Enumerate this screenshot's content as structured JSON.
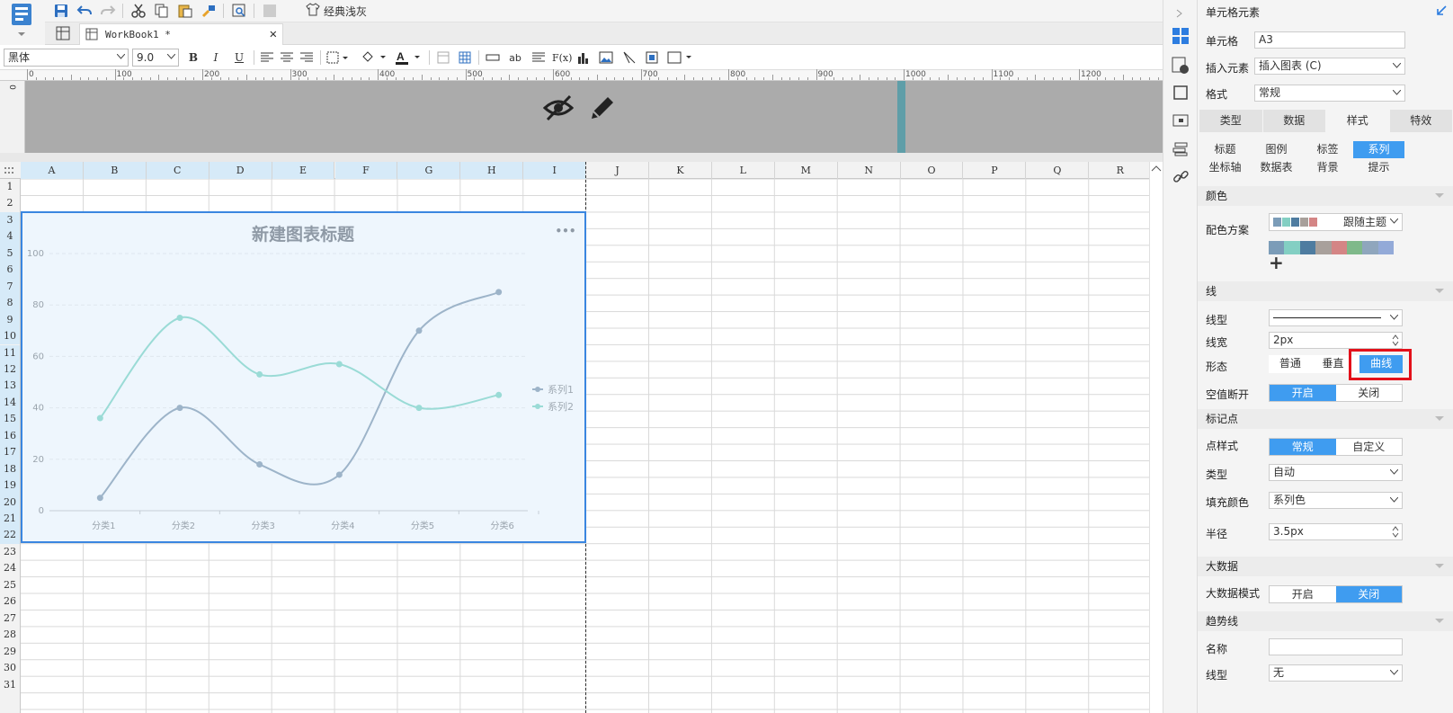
{
  "toolbar": {
    "theme_button": "经典浅灰",
    "font_name": "黑体",
    "font_size": "9.0",
    "bold": "B",
    "italic": "I",
    "underline": "U",
    "abc": "ab",
    "fx": "F(x)"
  },
  "tab": {
    "workbook": "WorkBook1 *"
  },
  "ruler": {
    "marks": [
      "0",
      "100",
      "200",
      "300",
      "400",
      "500",
      "600",
      "700",
      "800",
      "900",
      "1000",
      "1100",
      "1200"
    ]
  },
  "columns": [
    "A",
    "B",
    "C",
    "D",
    "E",
    "F",
    "G",
    "H",
    "I",
    "J",
    "K",
    "L",
    "M",
    "N",
    "O",
    "P",
    "Q",
    "R"
  ],
  "rows": [
    "1",
    "2",
    "3",
    "4",
    "5",
    "6",
    "7",
    "8",
    "9",
    "10",
    "11",
    "12",
    "13",
    "14",
    "15",
    "16",
    "17",
    "18",
    "19",
    "20",
    "21",
    "22",
    "23",
    "24",
    "25",
    "26",
    "27",
    "28",
    "29",
    "30",
    "31"
  ],
  "chart_data": {
    "type": "line",
    "title": "新建图表标题",
    "categories": [
      "分类1",
      "分类2",
      "分类3",
      "分类4",
      "分类5",
      "分类6"
    ],
    "series": [
      {
        "name": "系列1",
        "values": [
          5,
          40,
          18,
          14,
          70,
          85
        ],
        "color": "#9db4c9"
      },
      {
        "name": "系列2",
        "values": [
          36,
          75,
          53,
          57,
          40,
          45
        ],
        "color": "#9adbd6"
      }
    ],
    "yticks": [
      "0",
      "20",
      "40",
      "60",
      "80",
      "100"
    ],
    "ylim": [
      0,
      100
    ],
    "curve": "smooth",
    "legend": "right",
    "menu": "•••"
  },
  "panel": {
    "title": "单元格元素",
    "cell_label": "单元格",
    "cell_value": "A3",
    "insert_label": "插入元素",
    "insert_value": "插入图表 (C)",
    "format_label": "格式",
    "format_value": "常规",
    "tabs": [
      "类型",
      "数据",
      "样式",
      "特效"
    ],
    "subtabs_row1": [
      "标题",
      "图例",
      "标签",
      "系列"
    ],
    "subtabs_row2": [
      "坐标轴",
      "数据表",
      "背景",
      "提示"
    ],
    "color_section": "颜色",
    "scheme_label": "配色方案",
    "scheme_value": "跟随主题",
    "scheme_colors": [
      "#7b9cb8",
      "#83cfc3",
      "#4e7ca0",
      "#a8a09b",
      "#d48585",
      "#7fb98a",
      "#8fa6bd",
      "#93aad8"
    ],
    "plus": "+",
    "line_section": "线",
    "line_type_label": "线型",
    "line_width_label": "线宽",
    "line_width_value": "2px",
    "shape_label": "形态",
    "shape_options": [
      "普通",
      "垂直",
      "曲线"
    ],
    "null_break_label": "空值断开",
    "null_break_options": [
      "开启",
      "关闭"
    ],
    "marker_section": "标记点",
    "marker_style_label": "点样式",
    "marker_style_options": [
      "常规",
      "自定义"
    ],
    "marker_type_label": "类型",
    "marker_type_value": "自动",
    "fill_label": "填充颜色",
    "fill_value": "系列色",
    "radius_label": "半径",
    "radius_value": "3.5px",
    "bigdata_section": "大数据",
    "bigdata_mode_label": "大数据模式",
    "bigdata_options": [
      "开启",
      "关闭"
    ],
    "trend_section": "趋势线",
    "trend_name_label": "名称",
    "trend_name_value": "",
    "trend_type_label": "线型",
    "trend_type_value": "无"
  },
  "colors": {
    "accent": "#3f9cf0",
    "highlight": "#e3101a",
    "chart_border": "#3a86e0"
  }
}
